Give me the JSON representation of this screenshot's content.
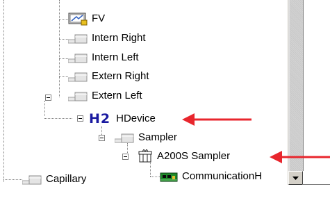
{
  "tree": {
    "items": [
      {
        "label": "FV",
        "icon": "fv-device-icon"
      },
      {
        "label": "Intern Right",
        "icon": "module-gray-icon"
      },
      {
        "label": "Intern Left",
        "icon": "module-gray-icon"
      },
      {
        "label": "Extern Right",
        "icon": "module-gray-icon"
      },
      {
        "label": "Extern Left",
        "icon": "module-gray-icon"
      },
      {
        "label": "HDevice",
        "icon": "h2-icon",
        "icon_text": "H2"
      },
      {
        "label": "Sampler",
        "icon": "module-gray-icon"
      },
      {
        "label": "A200S Sampler",
        "icon": "sampler-device-icon"
      },
      {
        "label": "CommunicationH",
        "icon": "green-board-icon"
      },
      {
        "label": "Capillary",
        "icon": "module-gray-icon"
      }
    ]
  },
  "colors": {
    "annotation_arrow": "#e8262d",
    "h2_text": "#1a1aa0",
    "board_green": "#1f8a2a"
  }
}
